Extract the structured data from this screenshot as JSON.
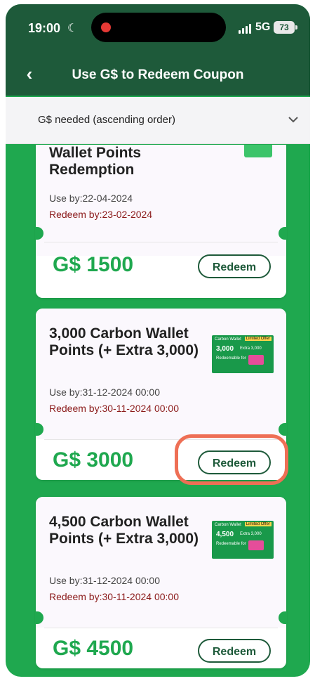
{
  "status": {
    "time": "19:00",
    "network": "5G",
    "battery": "73"
  },
  "header": {
    "title": "Use G$ to Redeem Coupon"
  },
  "sort": {
    "label": "G$ needed (ascending order)"
  },
  "coupons": [
    {
      "title_line1": "Wallet Points",
      "title_line2": "Redemption",
      "use_by": "Use by:22-04-2024",
      "redeem_by": "Redeem by:23-02-2024",
      "price": "G$ 1500",
      "button": "Redeem"
    },
    {
      "title": "3,000 Carbon Wallet Points (+ Extra 3,000)",
      "use_by": "Use by:31-12-2024 00:00",
      "redeem_by": "Redeem by:30-11-2024 00:00",
      "price": "G$ 3000",
      "button": "Redeem",
      "thumb": {
        "brand": "Carbon Wallet",
        "tag": "Limited Offer",
        "points": "3,000",
        "extra": "Extra 3,000",
        "note": "Redeemable for"
      }
    },
    {
      "title": "4,500 Carbon Wallet Points (+ Extra 3,000)",
      "use_by": "Use by:31-12-2024 00:00",
      "redeem_by": "Redeem by:30-11-2024 00:00",
      "price": "G$ 4500",
      "button": "Redeem",
      "thumb": {
        "brand": "Carbon Wallet",
        "tag": "Limited Offer",
        "points": "4,500",
        "extra": "Extra 3,000",
        "note": "Redeemable for"
      }
    }
  ],
  "colors": {
    "header": "#1e5a3a",
    "background": "#1fa84f",
    "price": "#1fa84f",
    "highlight": "#ee6f55"
  }
}
